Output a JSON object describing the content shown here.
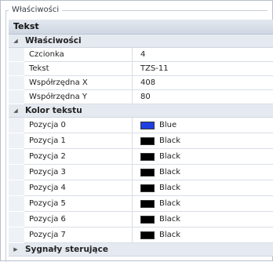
{
  "group_title": "Właściwości",
  "object_title": "Tekst",
  "categories": {
    "props": {
      "label": "Właściwości"
    },
    "color": {
      "label": "Kolor tekstu"
    },
    "signals": {
      "label": "Sygnały sterujące"
    }
  },
  "props_rows": [
    {
      "name": "Czcionka",
      "value": "4"
    },
    {
      "name": "Tekst",
      "value": "TZS-11"
    },
    {
      "name": "Współrzędna X",
      "value": "408"
    },
    {
      "name": "Współrzędna Y",
      "value": "80"
    }
  ],
  "color_rows": [
    {
      "name": "Pozycja 0",
      "value": "Blue",
      "color": "#1f3fe0"
    },
    {
      "name": "Pozycja 1",
      "value": "Black",
      "color": "#000000"
    },
    {
      "name": "Pozycja 2",
      "value": "Black",
      "color": "#000000"
    },
    {
      "name": "Pozycja 3",
      "value": "Black",
      "color": "#000000"
    },
    {
      "name": "Pozycja 4",
      "value": "Black",
      "color": "#000000"
    },
    {
      "name": "Pozycja 5",
      "value": "Black",
      "color": "#000000"
    },
    {
      "name": "Pozycja 6",
      "value": "Black",
      "color": "#000000"
    },
    {
      "name": "Pozycja 7",
      "value": "Black",
      "color": "#000000"
    }
  ],
  "icons": {
    "expanded": "triangle-down-icon",
    "collapsed": "triangle-right-icon"
  }
}
